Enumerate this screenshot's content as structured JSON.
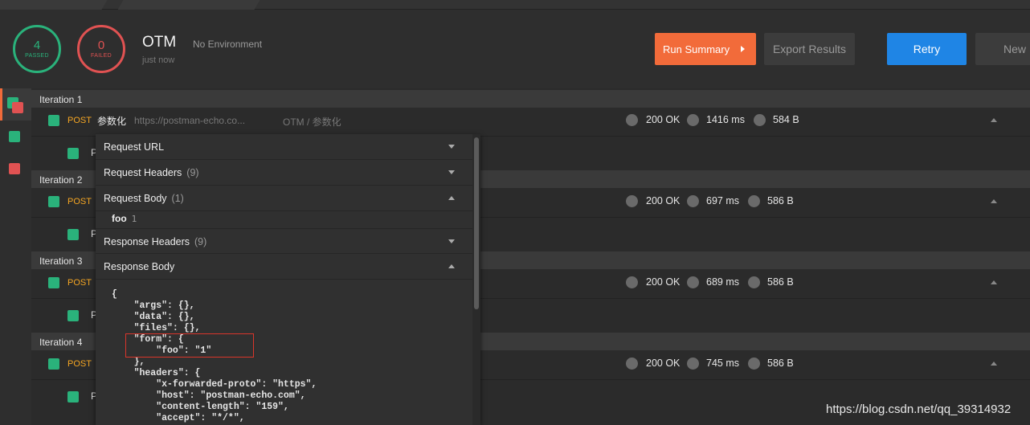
{
  "summary": {
    "passed": {
      "count": "4",
      "label": "PASSED"
    },
    "failed": {
      "count": "0",
      "label": "FAILED"
    },
    "collection_title": "OTM",
    "environment": "No Environment",
    "time": "just now"
  },
  "toolbar": {
    "run_summary": "Run Summary",
    "export_results": "Export Results",
    "retry": "Retry",
    "new": "New"
  },
  "iterations": [
    {
      "label": "Iteration 1",
      "method": "POST",
      "name": "参数化",
      "url": "https://postman-echo.co...",
      "collection": "OTM / 参数化",
      "status": "200 OK",
      "time": "1416 ms",
      "size": "584 B",
      "test_name": "P"
    },
    {
      "label": "Iteration 2",
      "method": "POST",
      "status": "200 OK",
      "time": "697 ms",
      "size": "586 B",
      "test_name": "P"
    },
    {
      "label": "Iteration 3",
      "method": "POST",
      "status": "200 OK",
      "time": "689 ms",
      "size": "586 B",
      "test_name": "P"
    },
    {
      "label": "Iteration 4",
      "method": "POST",
      "status": "200 OK",
      "time": "745 ms",
      "size": "586 B",
      "test_name": "P"
    }
  ],
  "details": {
    "request_url": "Request URL",
    "request_headers": {
      "label": "Request Headers",
      "count": "(9)"
    },
    "request_body": {
      "label": "Request Body",
      "count": "(1)"
    },
    "body_param": {
      "key": "foo",
      "value": "1"
    },
    "response_headers": {
      "label": "Response Headers",
      "count": "(9)"
    },
    "response_body": "Response Body",
    "response_json": "{\n    \"args\": {},\n    \"data\": {},\n    \"files\": {},\n    \"form\": {\n        \"foo\": \"1\"\n    },\n    \"headers\": {\n        \"x-forwarded-proto\": \"https\",\n        \"host\": \"postman-echo.com\",\n        \"content-length\": \"159\",\n        \"accept\": \"*/*\","
  },
  "watermark": "https://blog.csdn.net/qq_39314932",
  "colors": {
    "pass": "#2ab27b",
    "fail": "#e05252",
    "accent": "#f26b3a",
    "primary": "#1f85e5",
    "method": "#f5a623"
  }
}
